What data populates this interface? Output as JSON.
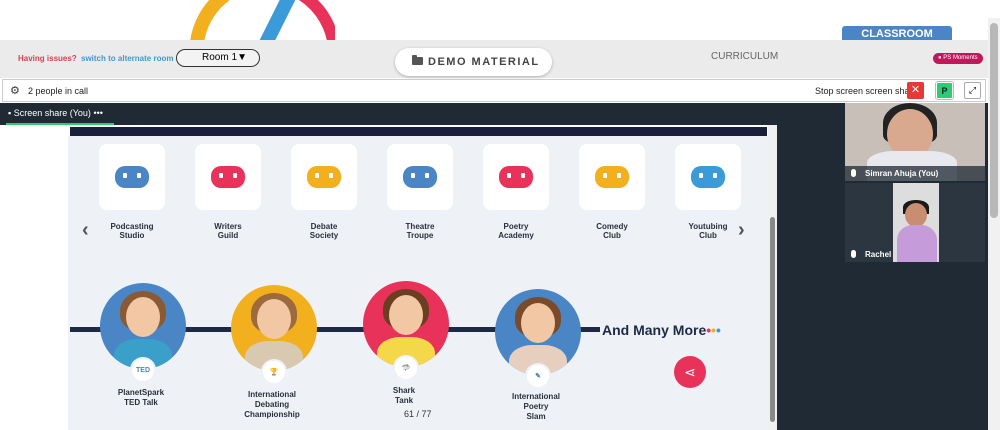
{
  "header": {
    "classroom_tab": "CLASSROOM",
    "accent_colors": {
      "classroom_tab": "#4a86c5",
      "ps_moments": "#c2185b",
      "brand_red": "#e8325a"
    }
  },
  "toolbar": {
    "issues_text": "Having issues?",
    "alt_room_link": "switch to alternate room",
    "room_select": {
      "selected": "Room 1",
      "caret": "▼"
    },
    "demo_material": "DEMO MATERIAL",
    "curriculum": "CURRICULUM",
    "ps_moments": "PS Moments"
  },
  "callbar": {
    "people_count": "2 people in call",
    "stop_sharing": "Stop screen screen sharing",
    "close_icon": "✕",
    "p_button": "P",
    "expand_icon": "⤢"
  },
  "screenshare": {
    "tab_label": "Screen share (You)",
    "more_icon": "•••"
  },
  "slide": {
    "clubs": [
      {
        "label1": "Podcasting",
        "label2": "Studio",
        "color": "#4a86c5"
      },
      {
        "label1": "Writers",
        "label2": "Guild",
        "color": "#e8325a"
      },
      {
        "label1": "Debate",
        "label2": "Society",
        "color": "#f2b01e"
      },
      {
        "label1": "Theatre",
        "label2": "Troupe",
        "color": "#4a86c5"
      },
      {
        "label1": "Poetry",
        "label2": "Academy",
        "color": "#e8325a"
      },
      {
        "label1": "Comedy",
        "label2": "Club",
        "color": "#f2b01e"
      },
      {
        "label1": "Youtubing",
        "label2": "Club",
        "color": "#3a9bd8"
      }
    ],
    "prev_arrow": "‹",
    "next_arrow": "›",
    "programs": [
      {
        "line1": "PlanetSpark",
        "line2": "TED Talk",
        "line3": "",
        "badge": "TED",
        "bg": "#4a86c5",
        "hair": "#8a5a34",
        "body": "#3aa0c9"
      },
      {
        "line1": "International",
        "line2": "Debating",
        "line3": "Championship",
        "badge": "🏆",
        "bg": "#f2b01e",
        "hair": "#9c6a3c",
        "body": "#d9c9b0"
      },
      {
        "line1": "Shark",
        "line2": "Tank",
        "line3": "",
        "badge": "🦈",
        "bg": "#e8325a",
        "hair": "#6b3e22",
        "body": "#f5d84a"
      },
      {
        "line1": "International",
        "line2": "Poetry",
        "line3": "Slam",
        "badge": "✎",
        "bg": "#4a86c5",
        "hair": "#7a4a2a",
        "body": "#e7cfc0"
      }
    ],
    "and_many_more": "And Many More",
    "dots": [
      "•",
      "•",
      "•"
    ],
    "share_icon": "⋖",
    "page_indicator": "61 / 77"
  },
  "participants": [
    {
      "name": "Simran Ahuja (You)"
    },
    {
      "name": "Rachel"
    }
  ]
}
